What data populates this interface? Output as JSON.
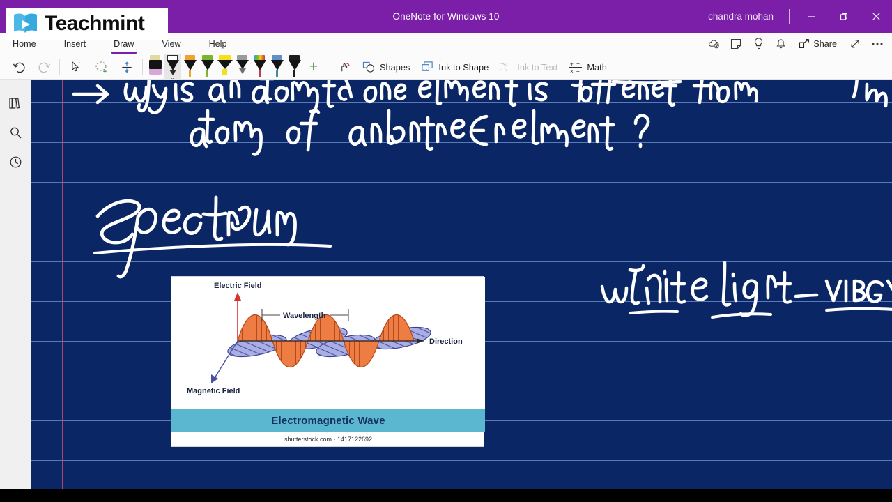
{
  "brand": {
    "name": "Teachmint",
    "icon": "teachmint-book-play-logo"
  },
  "titlebar": {
    "app_title": "OneNote for Windows 10",
    "user": "chandra mohan",
    "minimize": "minimize-icon",
    "restore": "restore-icon",
    "close": "close-icon",
    "accent_color": "#7b1fa8"
  },
  "menubar": {
    "tabs": [
      {
        "label": "Home",
        "active": false
      },
      {
        "label": "Insert",
        "active": false
      },
      {
        "label": "Draw",
        "active": true
      },
      {
        "label": "View",
        "active": false
      },
      {
        "label": "Help",
        "active": false
      }
    ],
    "right_icons": [
      {
        "name": "sync-cloud-icon"
      },
      {
        "name": "sticky-note-icon"
      },
      {
        "name": "lightbulb-icon"
      },
      {
        "name": "bell-notification-icon"
      }
    ],
    "share_label": "Share",
    "expand_icon": "expand-diagonal-icon",
    "more_icon": "more-ellipsis-icon"
  },
  "ribbon": {
    "undo": "undo-icon",
    "redo": "redo-icon",
    "redo_disabled": true,
    "select_text": "select-text-icon",
    "lasso_select": "lasso-select-icon",
    "insert_space": "insert-space-icon",
    "pens": [
      {
        "name": "eraser",
        "cap": "#e3d9a0",
        "tip": "#d7a8d7",
        "selected": false
      },
      {
        "name": "pen-black-selected",
        "cap": "#ffffff",
        "tip": "#2a2a2a",
        "selected": true
      },
      {
        "name": "pen-orange",
        "cap": "#f0a32a",
        "tip": "#f0a32a",
        "selected": false
      },
      {
        "name": "pen-green",
        "cap": "#7ab52c",
        "tip": "#7ab52c",
        "selected": false
      },
      {
        "name": "highlighter-yellow",
        "cap": "#f5e119",
        "tip": "#f5e119",
        "selected": false
      },
      {
        "name": "pencil-gray",
        "cap": "#9b9b9b",
        "tip": "#6e6e6e",
        "selected": false
      },
      {
        "name": "pen-rainbow-red",
        "cap": "#d8502e",
        "tip": "#c23b4e",
        "selected": false
      },
      {
        "name": "pen-blue",
        "cap": "#5f90c8",
        "tip": "#3f8f9c",
        "selected": false
      },
      {
        "name": "pen-black",
        "cap": "#1d1d1d",
        "tip": "#1d1d1d",
        "selected": false
      }
    ],
    "add_pen": "+",
    "lasso_tool": "lasso-hand-icon",
    "shapes_label": "Shapes",
    "ink_to_shape_label": "Ink to Shape",
    "ink_to_text_label": "Ink to Text",
    "ink_to_text_disabled": true,
    "math_label": "Math"
  },
  "rail": {
    "items": [
      {
        "name": "notebooks-icon"
      },
      {
        "name": "search-icon"
      },
      {
        "name": "recent-clock-icon"
      }
    ]
  },
  "page": {
    "background_color": "#0a2664",
    "rule_color": "#7a9ddb",
    "margin_color": "#d14a74",
    "ink_color": "#ffffff",
    "handwriting": [
      {
        "id": "question",
        "text": "→ why is an atom of one element is different from atom of another element ?"
      },
      {
        "id": "heading",
        "text": "Spectrum",
        "underlined": true
      },
      {
        "id": "note-right",
        "text": "white light – VIBGYOR",
        "underlined": true
      }
    ]
  },
  "embedded_image": {
    "caption": "Electromagnetic Wave",
    "watermark": "shutterstock.com · 1417122692",
    "caption_bar_color": "#5bb6cf",
    "labels": {
      "electric_field": "Electric Field",
      "magnetic_field": "Magnetic Field",
      "wavelength": "Wavelength",
      "direction": "Direction"
    },
    "wave_color": "#e8703a",
    "magnetic_color": "#8b8fd6"
  }
}
